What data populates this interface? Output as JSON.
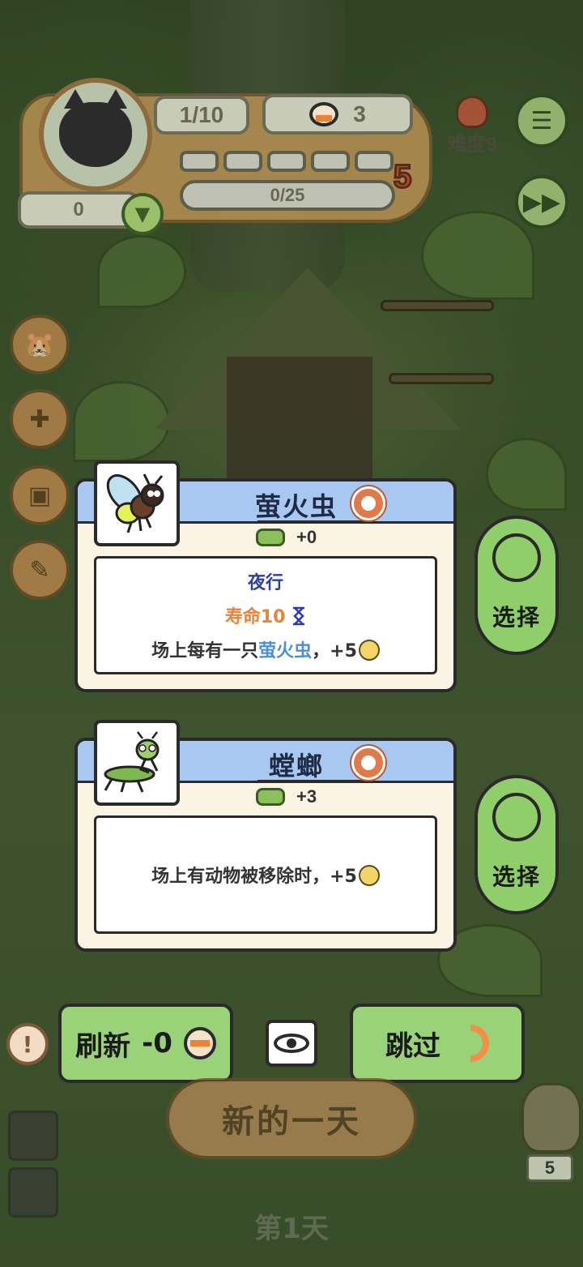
{
  "hud": {
    "slots": "1/10",
    "cans": "3",
    "difficulty": "难度9",
    "progress": "0/25",
    "level_badge": "5",
    "coins": "0",
    "segments_total": 5
  },
  "cards": [
    {
      "name": "萤火虫",
      "cost": "+0",
      "traits": [
        "夜行"
      ],
      "lifespan": "寿命10",
      "effect_prefix": "场上每有一只",
      "effect_keyword": "萤火虫",
      "effect_suffix": "，+5",
      "select_label": "选择"
    },
    {
      "name": "螳螂",
      "cost": "+3",
      "effect": "场上有动物被移除时，+5",
      "select_label": "选择"
    }
  ],
  "actions": {
    "refresh_label": "刷新",
    "refresh_cost": "-0",
    "skip_label": "跳过",
    "new_day_label": "新的一天",
    "day_label": "第1天",
    "queue_count": "5"
  },
  "colors": {
    "card_header": "#a8c8f2",
    "button_green": "#9ad27a",
    "keyword_night": "#2b3ea8",
    "keyword_life": "#e8833a",
    "keyword_blue": "#4f8fd8"
  }
}
